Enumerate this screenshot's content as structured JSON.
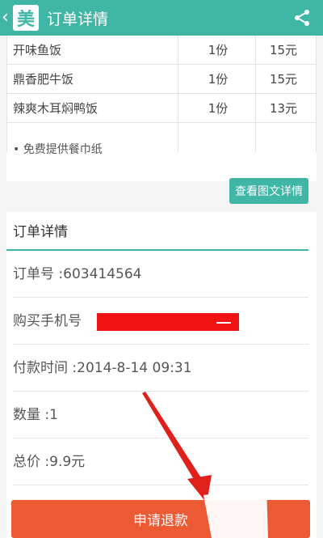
{
  "header": {
    "title": "订单详情",
    "logo_text": "美",
    "back_glyph": "‹",
    "icons": [
      "back-icon",
      "share-icon"
    ],
    "color": "#3fb6a6"
  },
  "order_items": [
    {
      "name": "开味鱼饭",
      "qty": "1份",
      "price": "15元"
    },
    {
      "name": "鼎香肥牛饭",
      "qty": "1份",
      "price": "15元"
    },
    {
      "name": "辣爽木耳焖鸭饭",
      "qty": "1份",
      "price": "13元"
    }
  ],
  "note": "• 免费提供餐巾纸",
  "detail_button": "查看图文详情",
  "details": {
    "section_title": "订单详情",
    "order_no": "订单号 :603414564",
    "phone_label": "购买手机号",
    "pay_time": "付款时间 :2014-8-14 09:31",
    "quantity": "数量 :1",
    "total": "总价 :9.9元"
  },
  "refund_button": "申请退款",
  "colors": {
    "accent": "#3fb6a6",
    "refund": "#ec5a33",
    "annotation": "#e0201b"
  }
}
